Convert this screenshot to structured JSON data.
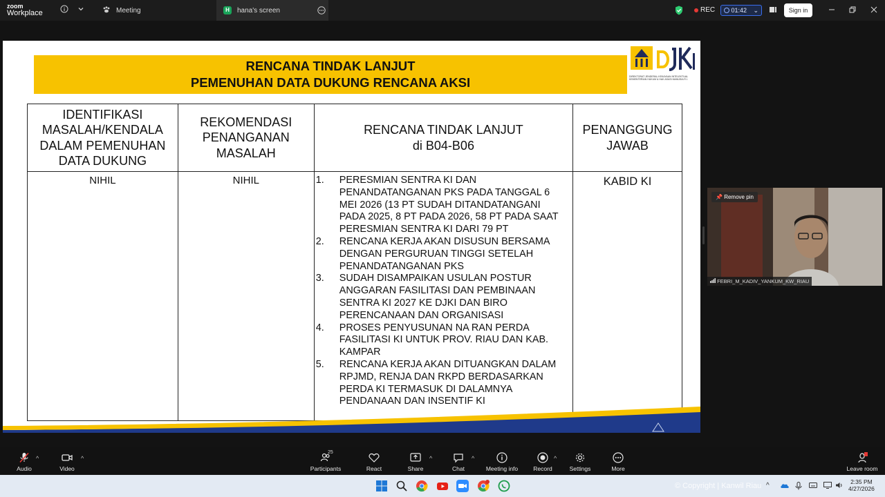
{
  "app": {
    "logo_line1": "zoom",
    "logo_line2": "Workplace",
    "tabs": [
      {
        "label": "Meeting",
        "icon": "paw-icon"
      },
      {
        "label": "hana's screen",
        "badge": "H",
        "icon": "screen-share-icon"
      }
    ],
    "rec_label": "REC",
    "timer": "01:42",
    "signin_label": "Sign in",
    "colors": {
      "accent": "#3a6ff0",
      "rec": "#e53935",
      "shield": "#2ecc71"
    }
  },
  "slide": {
    "title_line1": "RENCANA TINDAK LANJUT",
    "title_line2": "PEMENUHAN DATA DUKUNG RENCANA AKSI",
    "brand_mark": "DJKI",
    "brand_caption": "DIREKTORAT JENDERAL KEKAYAAN INTELEKTUAL KEMENTERIAN HUKUM & HAK ASASI MANUSIA R.I.",
    "headers": {
      "col1": "IDENTIFIKASI MASALAH/KENDALA DALAM PEMENUHAN DATA DUKUNG",
      "col2": "REKOMENDASI PENANGANAN MASALAH",
      "col3_line1": "RENCANA TINDAK LANJUT",
      "col3_line2": "di B04-B06",
      "col4": "PENANGGUNG JAWAB"
    },
    "col1_value": "NIHIL",
    "col2_value": "NIHIL",
    "col4_value": "KABID KI",
    "plan_items": [
      {
        "num": "1.",
        "text": "PERESMIAN SENTRA KI DAN PENANDATANGANAN PKS PADA TANGGAL 6 MEI 2026 (13 PT SUDAH DITANDATANGANI PADA 2025, 8 PT PADA 2026, 58 PT PADA SAAT PERESMIAN SENTRA KI DARI 79 PT"
      },
      {
        "num": "2.",
        "text": "RENCANA KERJA AKAN DISUSUN BERSAMA DENGAN PERGURUAN TINGGI SETELAH PENANDATANGANAN PKS"
      },
      {
        "num": "3.",
        "text": "SUDAH DISAMPAIKAN USULAN POSTUR ANGGARAN FASILITASI DAN PEMBINAAN SENTRA KI 2027 KE DJKI DAN BIRO PERENCANAAN DAN ORGANISASI"
      },
      {
        "num": "4.",
        "text": "PROSES PENYUSUNAN NA RAN PERDA FASILITASI KI UNTUK PROV. RIAU DAN KAB. KAMPAR"
      },
      {
        "num": "5.",
        "text": "RENCANA KERJA AKAN DITUANGKAN DALAM RPJMD, RENJA DAN RKPD BERDASARKAN PERDA KI TERMASUK DI DALAMNYA PENDANAAN DAN INSENTIF KI"
      }
    ]
  },
  "video": {
    "pin_label": "Remove pin",
    "participant_name": "FEBRI_M_KADIV_YANKUM_KW_RIAU"
  },
  "toolbar": {
    "audio": "Audio",
    "video": "Video",
    "participants": "Participants",
    "participants_count": "25",
    "react": "React",
    "share": "Share",
    "chat": "Chat",
    "meeting_info": "Meeting info",
    "record": "Record",
    "settings": "Settings",
    "more": "More",
    "leave": "Leave room"
  },
  "taskbar": {
    "time": "2:35 PM",
    "date": "4/27/2026",
    "watermark": "© Copyright | Kanwil Riau"
  }
}
